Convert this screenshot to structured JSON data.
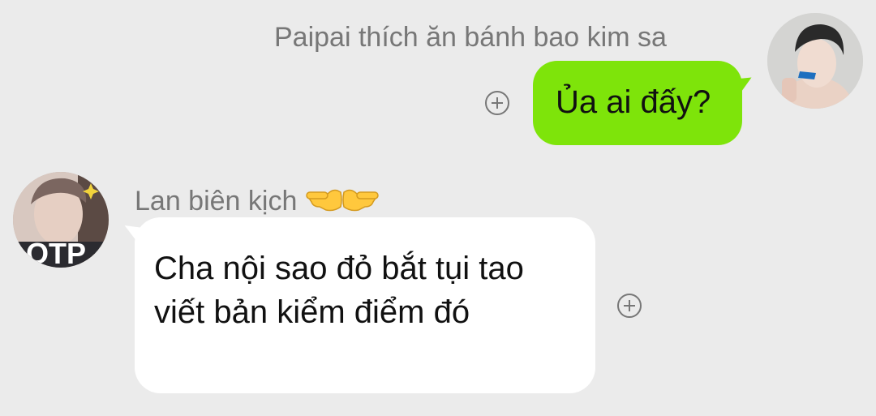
{
  "messages": [
    {
      "sender": "Paipai thích ăn bánh bao kim sa",
      "text": "Ủa ai đấy?",
      "direction": "outgoing",
      "bubble_color": "#7ee40a",
      "avatar_icon": "user-avatar-photo",
      "action_icon": "add-reaction-icon"
    },
    {
      "sender": "Lan biên kịch",
      "sender_badge_icon": "pointing-hands-emoji-icon",
      "text": "Cha nội sao đỏ bắt tụi tao viết bản kiểm điểm đó",
      "direction": "incoming",
      "bubble_color": "#ffffff",
      "avatar_icon": "user-avatar-photo",
      "avatar_overlay": "OTP",
      "action_icon": "add-reaction-icon"
    }
  ],
  "colors": {
    "background": "#ebebeb",
    "name_text": "#777777",
    "message_text": "#111111"
  }
}
